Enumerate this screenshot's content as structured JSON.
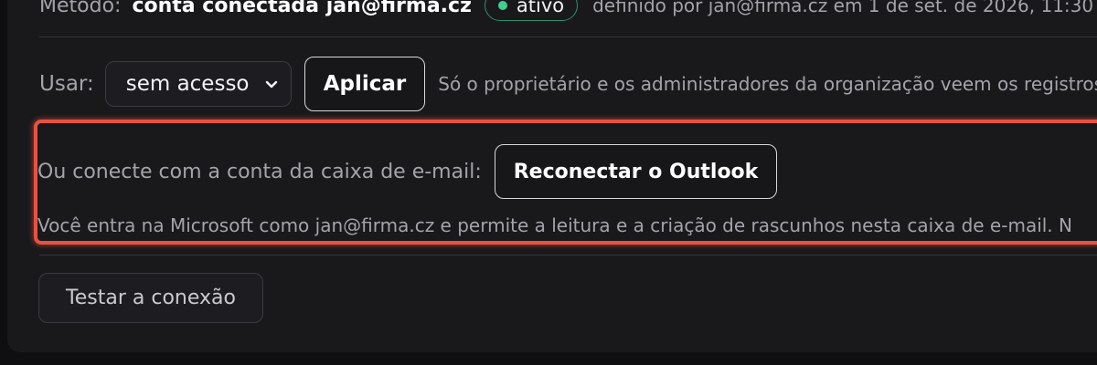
{
  "method_row": {
    "label": "Método:",
    "value": "conta conectada",
    "email": "jan@firma.cz",
    "status_badge": "ativo",
    "defined_by": "definido por jan@firma.cz em 1 de set. de 2026, 11:30"
  },
  "use_row": {
    "label": "Usar:",
    "select_value": "sem acesso",
    "apply_button": "Aplicar",
    "hint": "Só o proprietário e os administradores da organização veem os registros"
  },
  "connect_section": {
    "label": "Ou conecte com a conta da caixa de e-mail:",
    "reconnect_button": "Reconectar o Outlook",
    "note": "Você entra na Microsoft como jan@firma.cz e permite a leitura e a criação de rascunhos nesta caixa de e-mail. N"
  },
  "test_button": "Testar a conexão",
  "colors": {
    "background": "#0f0f11",
    "panel": "#19191c",
    "highlight_border": "#e85240",
    "status_green": "#3ecf8e"
  },
  "icons": {
    "status_dot": "status-dot-icon",
    "select_chevron": "chevron-down-icon"
  }
}
